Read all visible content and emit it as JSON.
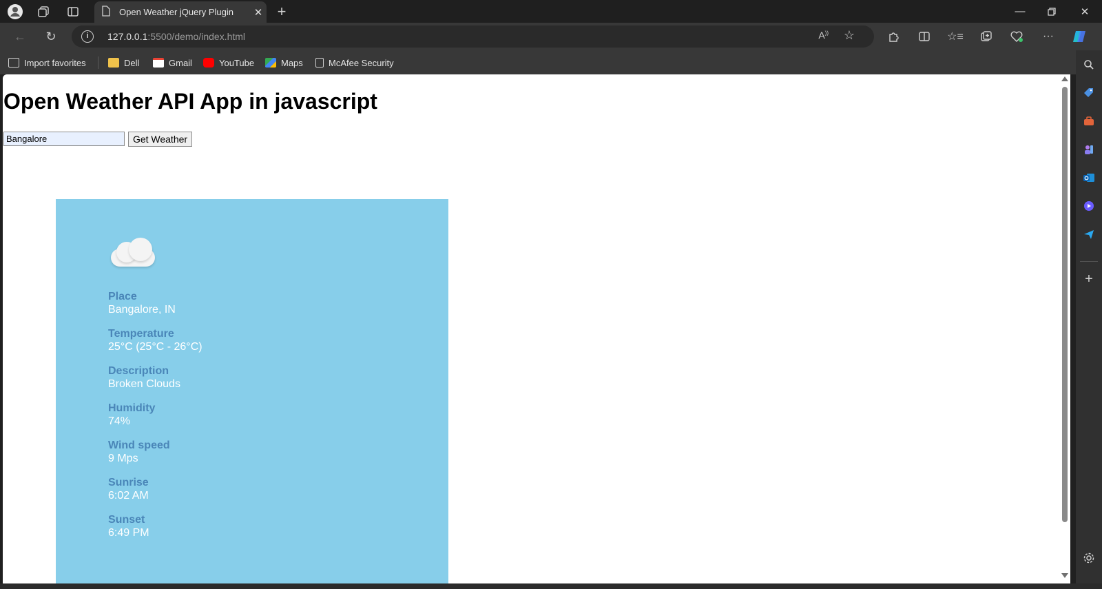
{
  "browser": {
    "tab_title": "Open Weather jQuery Plugin",
    "url_host": "127.0.0.1",
    "url_rest": ":5500/demo/index.html",
    "bookmarks": [
      {
        "label": "Import favorites",
        "color": "#cfcfcf"
      },
      {
        "label": "Dell",
        "color": "#f0c24b"
      },
      {
        "label": "Gmail",
        "color": "#ea4335"
      },
      {
        "label": "YouTube",
        "color": "#ff0000"
      },
      {
        "label": "Maps",
        "color": "#34a853"
      },
      {
        "label": "McAfee Security",
        "color": "#cfcfcf"
      }
    ]
  },
  "page": {
    "title": "Open Weather API App in javascript",
    "city_value": "Bangalore",
    "button_label": "Get Weather"
  },
  "weather": {
    "icon": "cloud-icon",
    "fields": [
      {
        "label": "Place",
        "value": "Bangalore, IN"
      },
      {
        "label": "Temperature",
        "value": "25°C (25°C - 26°C)"
      },
      {
        "label": "Description",
        "value": "Broken Clouds"
      },
      {
        "label": "Humidity",
        "value": "74%"
      },
      {
        "label": "Wind speed",
        "value": "9 Mps"
      },
      {
        "label": "Sunrise",
        "value": "6:02 AM"
      },
      {
        "label": "Sunset",
        "value": "6:49 PM"
      }
    ]
  },
  "colors": {
    "card_bg": "#87ceea",
    "label_color": "#4a86b8",
    "value_color": "#ffffff"
  }
}
